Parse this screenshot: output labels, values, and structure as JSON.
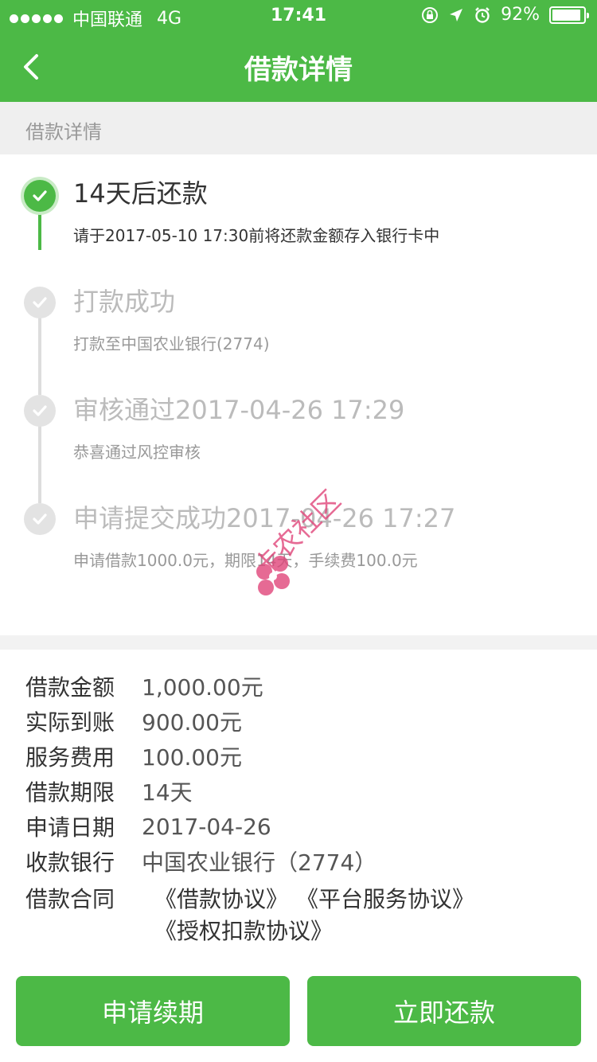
{
  "status_bar": {
    "carrier": "中国联通",
    "network": "4G",
    "time": "17:41",
    "battery": "92%",
    "battery_level": 0.92
  },
  "nav": {
    "title": "借款详情"
  },
  "section_label": "借款详情",
  "timeline": [
    {
      "title": "14天后还款",
      "subtitle": "请于2017-05-10 17:30前将还款金额存入银行卡中",
      "active": true
    },
    {
      "title": "打款成功",
      "subtitle": "打款至中国农业银行(2774)",
      "active": false
    },
    {
      "title": "审核通过2017-04-26 17:29",
      "subtitle": "恭喜通过风控审核",
      "active": false
    },
    {
      "title": "申请提交成功2017-04-26 17:27",
      "subtitle": "申请借款1000.0元，期限14天，手续费100.0元",
      "active": false
    }
  ],
  "details": {
    "amount": {
      "label": "借款金额",
      "value": "1,000.00元"
    },
    "received": {
      "label": "实际到账",
      "value": "900.00元"
    },
    "fee": {
      "label": "服务费用",
      "value": "100.00元"
    },
    "term": {
      "label": "借款期限",
      "value": "14天"
    },
    "apply_date": {
      "label": "申请日期",
      "value": "2017-04-26"
    },
    "bank": {
      "label": "收款银行",
      "value": "中国农业银行（2774）"
    },
    "contract": {
      "label": "借款合同",
      "links": [
        "《借款协议》",
        "《平台服务协议》",
        "《授权扣款协议》"
      ]
    }
  },
  "buttons": {
    "renew": "申请续期",
    "repay": "立即还款"
  },
  "watermark": {
    "text": "卡农社区"
  },
  "colors": {
    "brand_green": "#4cb946",
    "inactive_gray": "#e3e3e3"
  }
}
